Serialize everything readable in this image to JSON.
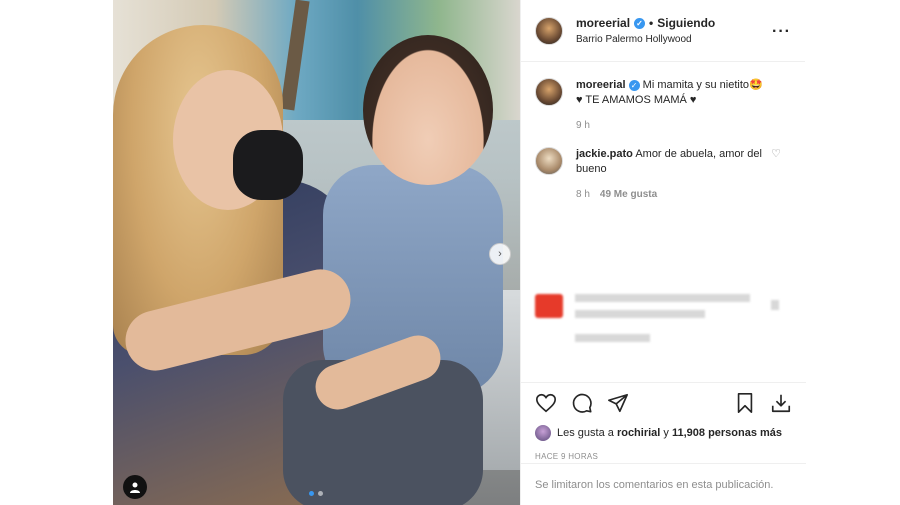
{
  "header": {
    "username": "moreerial",
    "follow_status": "Siguiendo",
    "separator": "•",
    "location": "Barrio Palermo Hollywood",
    "more_icon": "more-icon"
  },
  "caption": {
    "username": "moreerial",
    "text": "Mi mamita y su nietito🤩",
    "text2": "♥ TE AMAMOS MAMÁ ♥",
    "time": "9 h"
  },
  "comments": [
    {
      "username": "jackie.pato",
      "text": "Amor de abuela, amor del bueno",
      "time": "8 h",
      "likes": "49 Me gusta"
    }
  ],
  "likes": {
    "prefix": "Les gusta a",
    "user": "rochirial",
    "joiner": "y",
    "count": "11,908 personas más"
  },
  "timestamp": "HACE 9 HORAS",
  "footer_text": "Se limitaron los comentarios en esta publicación.",
  "colors": {
    "verified": "#3897f0",
    "muted": "#8e8e8e",
    "text": "#262626"
  }
}
